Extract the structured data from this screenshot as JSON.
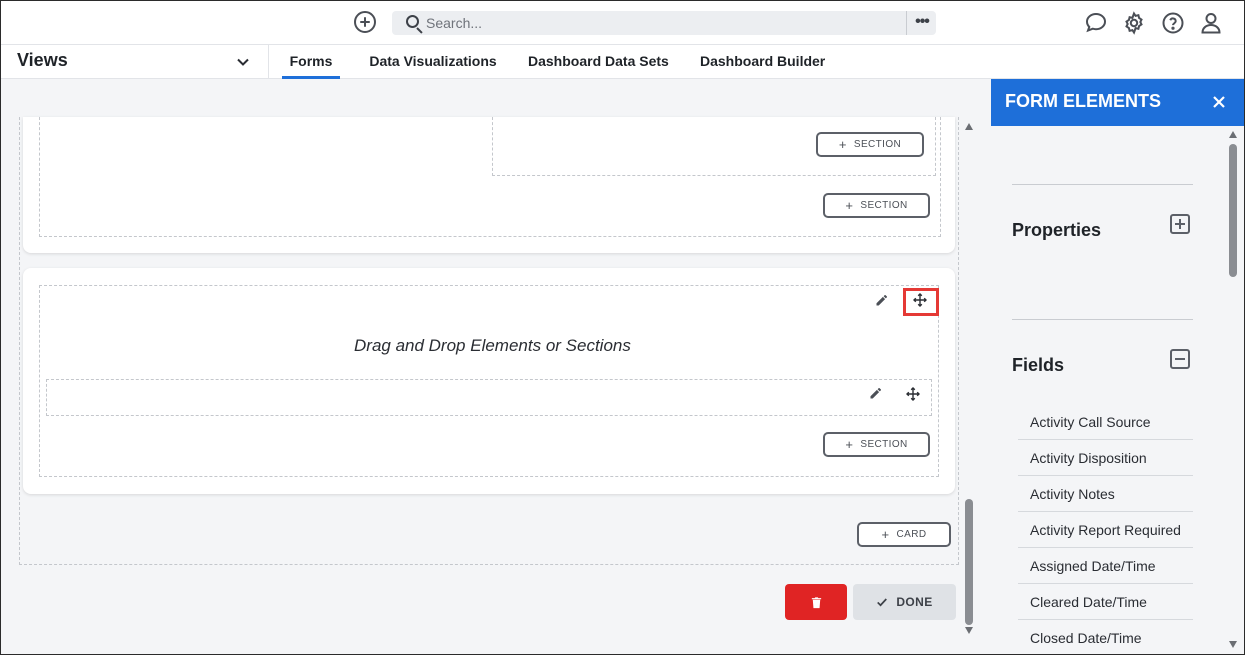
{
  "topbar": {
    "search_placeholder": "Search...",
    "more_label": "•••"
  },
  "views_bar": {
    "title": "Views",
    "tabs": [
      {
        "label": "Forms",
        "active": true
      },
      {
        "label": "Data Visualizations",
        "active": false
      },
      {
        "label": "Dashboard Data Sets",
        "active": false
      },
      {
        "label": "Dashboard Builder",
        "active": false
      }
    ]
  },
  "canvas": {
    "section_button_label": "SECTION",
    "card_button_label": "CARD",
    "drop_hint": "Drag and Drop Elements or Sections",
    "done_label": "DONE"
  },
  "panel": {
    "title": "FORM ELEMENTS",
    "properties_label": "Properties",
    "fields_label": "Fields",
    "fields": [
      "Activity Call Source",
      "Activity Disposition",
      "Activity Notes",
      "Activity Report Required",
      "Assigned Date/Time",
      "Cleared Date/Time",
      "Closed Date/Time"
    ]
  },
  "colors": {
    "accent": "#1e6fd9",
    "danger": "#e02424",
    "highlight": "#e53935",
    "canvas_bg": "#f4f5f7"
  }
}
